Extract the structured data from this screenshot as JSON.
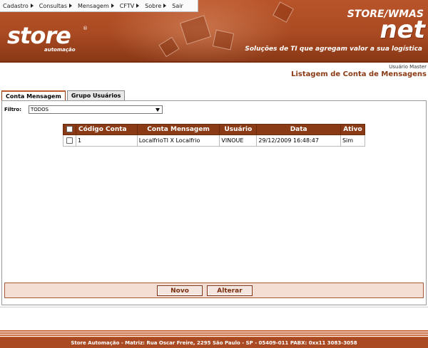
{
  "menu": [
    {
      "label": "Cadastro"
    },
    {
      "label": "Consultas"
    },
    {
      "label": "Mensagem"
    },
    {
      "label": "CFTV"
    },
    {
      "label": "Sobre"
    },
    {
      "label": "Sair"
    }
  ],
  "header": {
    "logo_text": "store",
    "logo_reg": "®",
    "logo_sub": "automação",
    "brand_top": "STORE/WMAS",
    "brand_net": "net",
    "tagline": "Soluções de TI que agregam valor a sua logística"
  },
  "user": "Usuário Master",
  "page_title": "Listagem de Conta de Mensagens",
  "tabs": [
    {
      "label": "Conta Mensagem",
      "active": true
    },
    {
      "label": "Grupo Usuários",
      "active": false
    }
  ],
  "filter": {
    "label": "Filtro:",
    "selected": "TODOS"
  },
  "table": {
    "columns": [
      "Código Conta",
      "Conta Mensagem",
      "Usuário",
      "Data",
      "Ativo"
    ],
    "rows": [
      [
        "1",
        "LocalfrioTI X Localfrio",
        "VINOUE",
        "29/12/2009 16:48:47",
        "Sim"
      ]
    ]
  },
  "buttons": {
    "new_label": "Novo",
    "edit_label": "Alterar"
  },
  "footer": "Store Automação - Matriz: Rua Oscar Freire, 2295 São Paulo - SP - 05409-011 PABX: 0xx11 3083-3058",
  "colors": {
    "brand": "#a94a22",
    "header_dark": "#8a3a14",
    "button_bar": "#f4ddd2"
  }
}
